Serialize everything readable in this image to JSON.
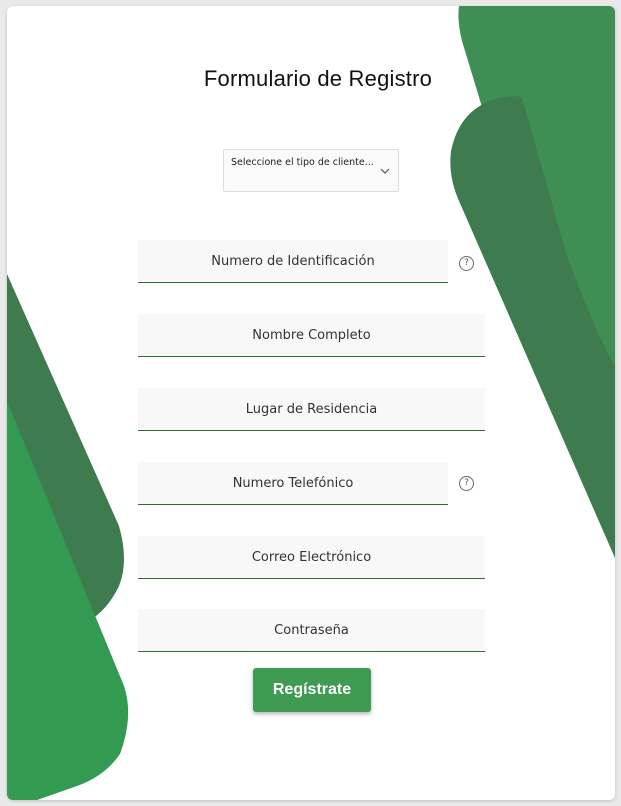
{
  "form": {
    "title": "Formulario de Registro",
    "client_type_select": {
      "selected": "Seleccione el tipo de cliente...",
      "icon": "chevron-down-icon"
    },
    "fields": {
      "id_number": "Numero de Identificación",
      "full_name": "Nombre Completo",
      "residence": "Lugar de Residencia",
      "phone": "Numero Telefónico",
      "email": "Correo Electrónico",
      "password": "Contraseña"
    },
    "help_icon": {
      "glyph": "?",
      "icon": "help-circle-icon"
    },
    "submit_label": "Regístrate"
  },
  "colors": {
    "green_light": "#3f9a52",
    "green_mid": "#3f8f55",
    "green_dark": "#3e7b4f",
    "field_bg": "#f8f8f8",
    "underline": "#2f6b34"
  }
}
